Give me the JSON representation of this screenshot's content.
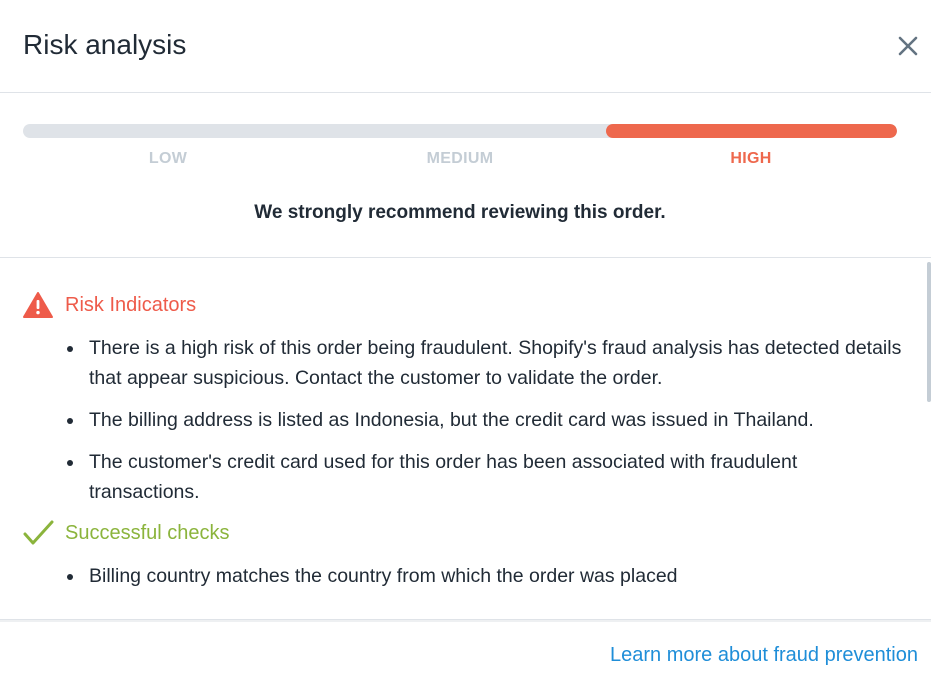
{
  "header": {
    "title": "Risk analysis",
    "close_icon": "close-icon"
  },
  "risk_meter": {
    "levels": [
      "LOW",
      "MEDIUM",
      "HIGH"
    ],
    "active_level": "HIGH",
    "fill_fraction_start": 0.667,
    "colors": {
      "active": "#ee684d",
      "inactive_label": "#c4cdd5",
      "track": "#dfe3e8"
    },
    "recommendation": "We strongly recommend reviewing this order."
  },
  "risk_indicators": {
    "heading": "Risk Indicators",
    "icon": "warning-triangle-icon",
    "color": "#ee5b4a",
    "items": [
      "There is a high risk of this order being fraudulent. Shopify's fraud analysis has detected details that appear suspicious. Contact the customer to validate the order.",
      "The billing address is listed as Indonesia, but the credit card was issued in Thailand.",
      "The customer's credit card used for this order has been associated with fraudulent transactions."
    ]
  },
  "successful_checks": {
    "heading": "Successful checks",
    "icon": "checkmark-icon",
    "color": "#8bb43c",
    "items": [
      "Billing country matches the country from which the order was placed"
    ]
  },
  "footer": {
    "link_text": "Learn more about fraud prevention"
  }
}
